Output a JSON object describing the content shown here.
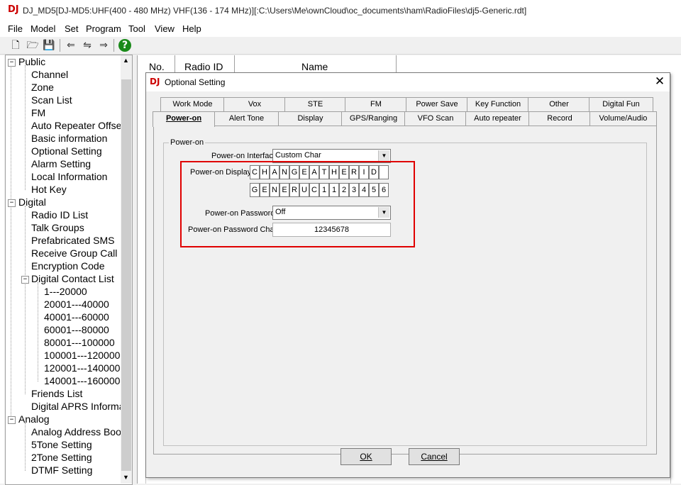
{
  "window": {
    "logo": "DJ",
    "title": "DJ_MD5[DJ-MD5:UHF(400 - 480 MHz) VHF(136 - 174 MHz)][:C:\\Users\\Me\\ownCloud\\oc_documents\\ham\\RadioFiles\\dj5-Generic.rdt]"
  },
  "menu": [
    "File",
    "Model",
    "Set",
    "Program",
    "Tool",
    "View",
    "Help"
  ],
  "toolbar": {
    "icons": [
      "new-file-icon",
      "open-folder-icon",
      "save-icon",
      "read-radio-icon",
      "write-radio-icon",
      "radio-info-icon",
      "help-icon"
    ],
    "glyphs": [
      "🗋",
      "🗁",
      "💾",
      "⇐",
      "⇋",
      "⇒",
      "?"
    ]
  },
  "tree": {
    "public": {
      "label": "Public",
      "children": [
        "Channel",
        "Zone",
        "Scan List",
        "FM",
        "Auto Repeater Offse",
        "Basic information",
        "Optional Setting",
        "Alarm Setting",
        "Local Information",
        "Hot Key"
      ]
    },
    "digital": {
      "label": "Digital",
      "children": [
        "Radio ID List",
        "Talk Groups",
        "Prefabricated SMS",
        "Receive Group Call",
        "Encryption Code"
      ],
      "contact_list": {
        "label": "Digital Contact List",
        "children": [
          "1---20000",
          "20001---40000",
          "40001---60000",
          "60001---80000",
          "80001---100000",
          "100001---120000",
          "120001---140000",
          "140001---160000"
        ]
      },
      "after": [
        "Friends List",
        "Digital APRS Informa"
      ]
    },
    "analog": {
      "label": "Analog",
      "children": [
        "Analog Address Boo",
        "5Tone Setting",
        "2Tone Setting",
        "DTMF Setting"
      ]
    }
  },
  "grid": {
    "columns": [
      "No.",
      "Radio ID",
      "Name"
    ]
  },
  "dialog": {
    "logo": "DJ",
    "title": "Optional Setting",
    "close": "✕",
    "tabs_top": [
      "Work Mode",
      "Vox",
      "STE",
      "FM",
      "Power Save",
      "Key Function",
      "Other",
      "Digital Fun"
    ],
    "tabs_bottom": [
      "Power-on",
      "Alert Tone",
      "Display",
      "GPS/Ranging",
      "VFO Scan",
      "Auto repeater",
      "Record",
      "Volume/Audio"
    ],
    "active_tab": "Power-on",
    "group_title": "Power-on",
    "power_on_interface": {
      "label": "Power-on Interface",
      "value": "Custom Char"
    },
    "power_on_display": {
      "label": "Power-on Display",
      "line1": [
        "C",
        "H",
        "A",
        "N",
        "G",
        "E",
        "A",
        "T",
        "H",
        "E",
        "R",
        "I",
        "D",
        ""
      ],
      "line2": [
        "G",
        "E",
        "N",
        "E",
        "R",
        "U",
        "C",
        "1",
        "1",
        "2",
        "3",
        "4",
        "5",
        "6"
      ]
    },
    "power_on_password": {
      "label": "Power-on Password",
      "value": "Off"
    },
    "power_on_password_char": {
      "label": "Power-on Password Char",
      "value": "12345678"
    },
    "ok_label": "OK",
    "cancel_label": "Cancel",
    "highlight_color": "#e00000"
  }
}
